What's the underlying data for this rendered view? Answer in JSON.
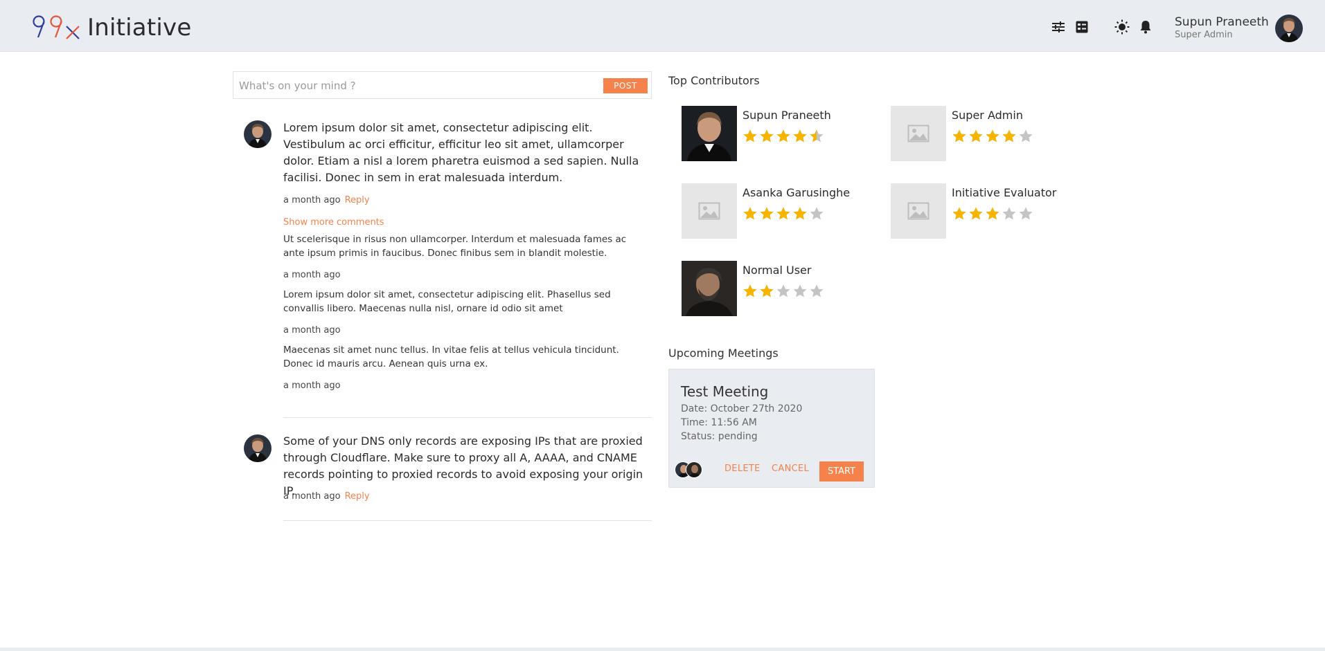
{
  "app": {
    "logo_text": "Initiative",
    "accent": "#f5824a",
    "header_bg": "#e9edf1"
  },
  "header": {
    "icons": [
      "sliders-icon",
      "list-view-icon",
      "sun-icon",
      "bell-icon"
    ],
    "user_name": "Supun Praneeth",
    "user_role": "Super Admin"
  },
  "composer": {
    "placeholder": "What's on your mind ?",
    "value": "",
    "post_label": "POST"
  },
  "feed": {
    "posts": [
      {
        "text": "Lorem ipsum dolor sit amet, consectetur adipiscing elit. Vestibulum ac orci efficitur, efficitur leo sit amet, ullamcorper dolor. Etiam a nisl a lorem pharetra euismod a sed sapien. Nulla facilisi. Donec in sem in erat malesuada interdum.",
        "time": "a month ago",
        "reply_label": "Reply",
        "show_more_label": "Show more comments",
        "comments": [
          {
            "text": "Ut scelerisque in risus non ullamcorper. Interdum et malesuada fames ac ante ipsum primis in faucibus. Donec finibus sem in blandit molestie.",
            "time": "a month ago"
          },
          {
            "text": "Lorem ipsum dolor sit amet, consectetur adipiscing elit. Phasellus sed convallis libero. Maecenas nulla nisl, ornare id odio sit amet",
            "time": "a month ago"
          },
          {
            "text": "Maecenas sit amet nunc tellus. In vitae felis at tellus vehicula tincidunt. Donec id mauris arcu. Aenean quis urna ex.",
            "time": "a month ago"
          }
        ]
      },
      {
        "text": "Some of your DNS only records are exposing IPs that are proxied through Cloudflare. Make sure to proxy all A, AAAA, and CNAME records pointing to proxied records to avoid exposing your origin IP.",
        "time": "a month ago",
        "reply_label": "Reply"
      }
    ]
  },
  "contributors": {
    "title": "Top Contributors",
    "items": [
      {
        "name": "Supun Praneeth",
        "rating": 4.5,
        "photo": "photo"
      },
      {
        "name": "Super Admin",
        "rating": 4,
        "photo": "placeholder"
      },
      {
        "name": "Asanka Garusinghe",
        "rating": 4,
        "photo": "placeholder"
      },
      {
        "name": "Initiative Evaluator",
        "rating": 3,
        "photo": "placeholder"
      },
      {
        "name": "Normal User",
        "rating": 2,
        "photo": "photo"
      }
    ],
    "star_color": "#f4b400",
    "star_empty_color": "#c4c4c4"
  },
  "meetings": {
    "title": "Upcoming Meetings",
    "items": [
      {
        "title": "Test Meeting",
        "date": "Date: October 27th 2020",
        "time": "Time: 11:56 AM",
        "status": "Status: pending",
        "delete_label": "DELETE",
        "cancel_label": "CANCEL",
        "start_label": "START"
      }
    ]
  }
}
